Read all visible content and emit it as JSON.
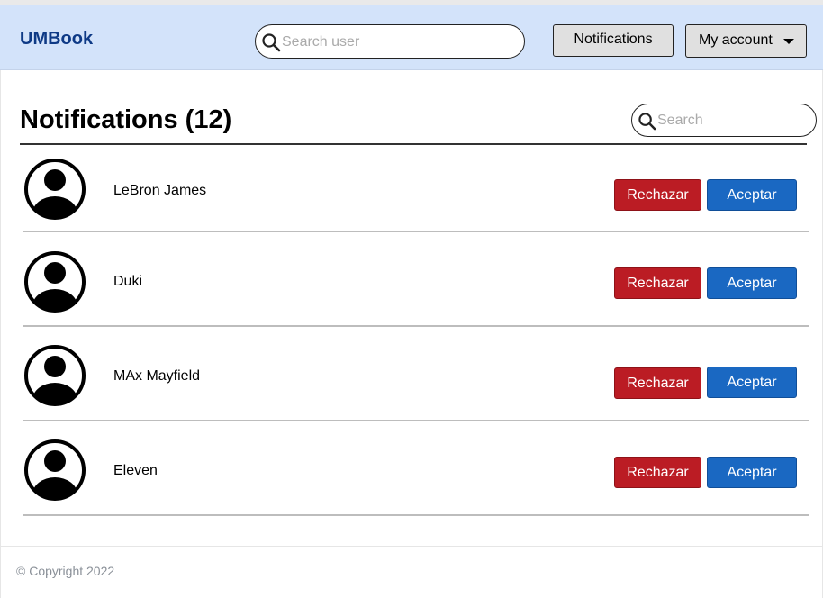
{
  "header": {
    "brand": "UMBook",
    "search_placeholder": "Search user",
    "notifications_label": "Notifications",
    "account_label": "My account"
  },
  "main": {
    "title": "Notifications (12)",
    "search_placeholder": "Search",
    "notifications": [
      {
        "name": "LeBron James",
        "reject_label": "Rechazar",
        "accept_label": "Aceptar"
      },
      {
        "name": "Duki",
        "reject_label": "Rechazar",
        "accept_label": "Aceptar"
      },
      {
        "name": "MAx Mayfield",
        "reject_label": "Rechazar",
        "accept_label": "Aceptar"
      },
      {
        "name": "Eleven",
        "reject_label": "Rechazar",
        "accept_label": "Aceptar"
      }
    ]
  },
  "footer": {
    "copyright": "© Copyright 2022"
  },
  "colors": {
    "header_bg": "#d3e3fa",
    "brand": "#0e3a86",
    "reject": "#bb1c24",
    "accept": "#1a68c2"
  },
  "icons": {
    "search": "search-icon",
    "caret": "chevron-down-icon",
    "avatar": "user-avatar-icon"
  }
}
